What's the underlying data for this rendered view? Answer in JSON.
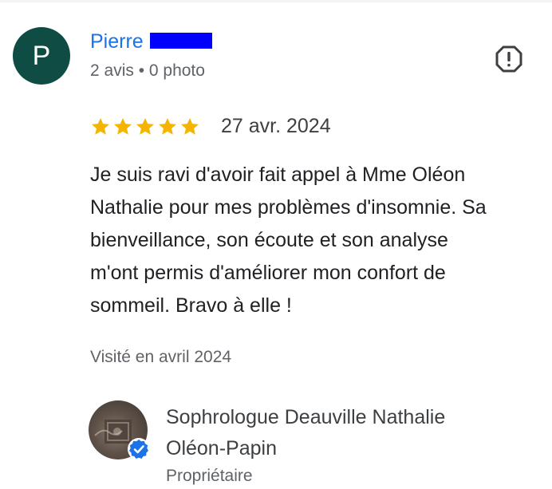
{
  "reviewer": {
    "initial": "P",
    "avatar_color": "#0f4d44",
    "name": "Pierre",
    "name_redacted": true,
    "redaction_color": "#0000ff",
    "meta": "2 avis • 0 photo"
  },
  "review": {
    "rating": 5,
    "max_rating": 5,
    "star_color": "#f4b400",
    "date": "27 avr. 2024",
    "text_lines": [
      "Je suis ravi d'avoir fait appel à Mme Oléon",
      "Nathalie pour mes problèmes d'insomnie. Sa",
      "bienveillance, son écoute et son analyse",
      "m'ont permis d'améliorer mon confort de",
      "sommeil. Bravo à elle !"
    ],
    "visited": "Visité en avril 2024"
  },
  "owner_response": {
    "name_lines": [
      "Sophrologue Deauville Nathalie",
      "Oléon-Papin"
    ],
    "role": "Propriétaire",
    "verified_badge_color": "#1a73e8",
    "avatar_icon": "business-logo-avatar"
  },
  "icons": {
    "report": "report-flag-icon",
    "star": "star-icon",
    "verified": "verified-check-icon"
  }
}
